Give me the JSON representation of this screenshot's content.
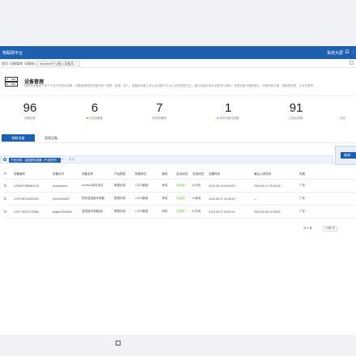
{
  "app": {
    "title": "物联网平台",
    "user": "系统大屏",
    "more": "⋮"
  },
  "breadcrumbs": [
    {
      "label": "首页"
    },
    {
      "label": "设备管理"
    },
    {
      "label": "设备接入"
    },
    {
      "label": "ModbusRTU接入设备页",
      "close": "×"
    }
  ],
  "header": {
    "title": "设备管理",
    "description": "物联网设备属于某个产品下的具体设备，设备管理提供设备的统一管理，新建、导入、设备和设备之间以及设备与平台之间的数据交互，通过设备名称对设备进行搜索，查看设备详情等操作，设备参数设置，物模型数据，日志查看等。"
  },
  "stats": [
    {
      "value": "96",
      "label": "设备总数"
    },
    {
      "value": "6",
      "label": "在线设备数",
      "dot": true
    },
    {
      "value": "7",
      "label": "网关设备数"
    },
    {
      "value": "1",
      "label": "网关设备在线数",
      "dot": true
    },
    {
      "value": "91",
      "label": "已经启用数"
    },
    {
      "value": "",
      "label": "未启"
    }
  ],
  "tabs": {
    "active": "物联设备",
    "inactive": "视频设备"
  },
  "filter": {
    "tag": "产品分类：温湿度传感器（产品型号）",
    "close": "×",
    "placeholder": "筛选",
    "query": "查询"
  },
  "table": {
    "headers": [
      "",
      "设备编号",
      "设备标识",
      "设备名称",
      "产品类型",
      "所属单位",
      "接线",
      "启动状态",
      "在线状态",
      "创建时间",
      "最后上线时间",
      "所属"
    ],
    "rows": [
      [
        "",
        "1786307565063143",
        "modbustest",
        "modbus协议测试",
        "数据传感",
        "CJSX集团",
        "有线",
        "已启用",
        "在线",
        "2024-05-15 15:05:00",
        "2024-06-17 15:40:20",
        "广安"
      ],
      [
        "",
        "1787295761923153",
        "rehw3345467",
        "物流温湿度传感器",
        "数据传感",
        "CJSX集团",
        "有线",
        "已启用",
        "离线",
        "2024-05-07 09:45:20",
        "—",
        "广安"
      ],
      [
        "",
        "1787706574275586",
        "brgeto2345466",
        "温湿度传感器(温..",
        "数据传感",
        "CJSX集团",
        "网线",
        "已启用",
        "在线",
        "2024-05-07 09:54:19",
        "2024-05-08 16:38:40",
        "广安"
      ]
    ]
  },
  "pager": {
    "total": "共 3 条",
    "size": "10条/页"
  }
}
